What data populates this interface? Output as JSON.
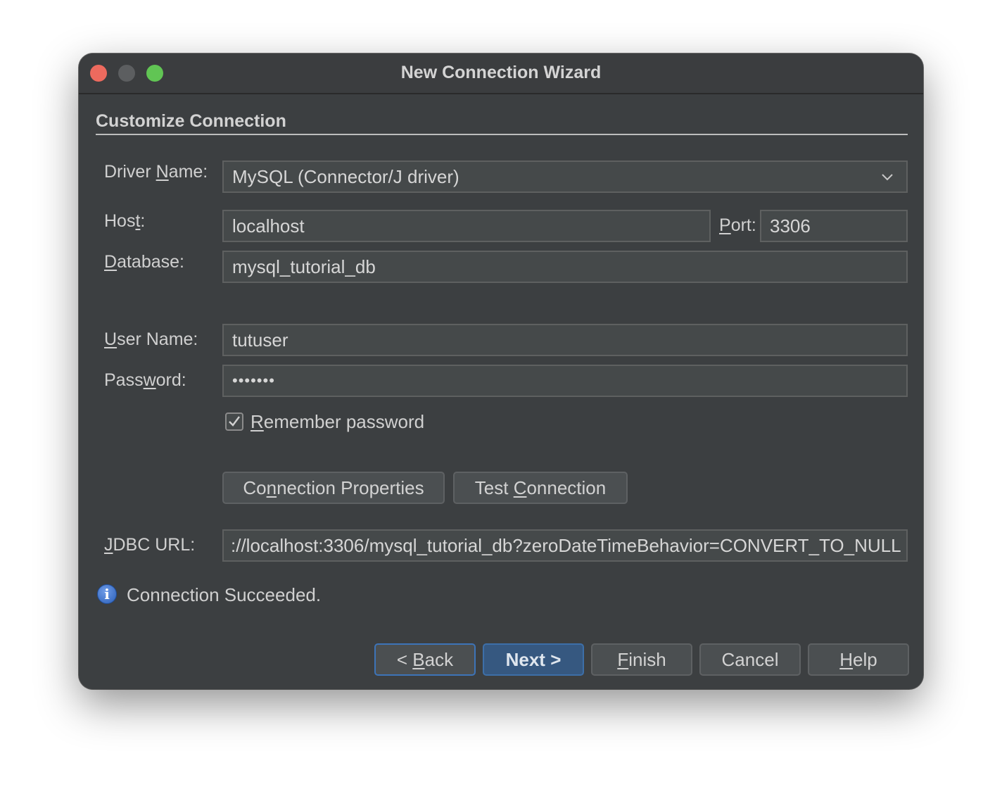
{
  "window": {
    "title": "New Connection Wizard"
  },
  "section": {
    "title": "Customize Connection"
  },
  "form": {
    "driver": {
      "label_pre": "Driver ",
      "label_mn": "N",
      "label_post": "ame:",
      "value": "MySQL (Connector/J driver)"
    },
    "host": {
      "label_pre": "Hos",
      "label_mn": "t",
      "label_post": ":",
      "value": "localhost"
    },
    "port": {
      "label_pre": "",
      "label_mn": "P",
      "label_post": "ort:",
      "value": "3306"
    },
    "database": {
      "label_pre": "",
      "label_mn": "D",
      "label_post": "atabase:",
      "value": "mysql_tutorial_db"
    },
    "username": {
      "label_pre": "",
      "label_mn": "U",
      "label_post": "ser Name:",
      "value": "tutuser"
    },
    "password": {
      "label_pre": "Pass",
      "label_mn": "w",
      "label_post": "ord:",
      "value": "•••••••"
    },
    "remember": {
      "label_pre": "",
      "label_mn": "R",
      "label_post": "emember password",
      "checked": true
    },
    "jdbc": {
      "label_pre": "",
      "label_mn": "J",
      "label_post": "DBC URL:",
      "value": "://localhost:3306/mysql_tutorial_db?zeroDateTimeBehavior=CONVERT_TO_NULL"
    }
  },
  "actions": {
    "connection_properties": {
      "pre": "Co",
      "mn": "n",
      "post": "nection Properties"
    },
    "test_connection": {
      "pre": "Test ",
      "mn": "C",
      "post": "onnection"
    }
  },
  "status": {
    "icon": "info-icon",
    "icon_glyph": "i",
    "text": "Connection Succeeded."
  },
  "footer": {
    "back": {
      "pre": "< ",
      "mn": "B",
      "post": "ack"
    },
    "next": {
      "label": "Next >"
    },
    "finish": {
      "pre": "",
      "mn": "F",
      "post": "inish"
    },
    "cancel": {
      "label": "Cancel"
    },
    "help": {
      "pre": "",
      "mn": "H",
      "post": "elp"
    }
  },
  "colors": {
    "dialog_bg": "#3c3f41",
    "field_bg": "#45494a",
    "default_button": "#365880",
    "focus_border": "#3d74b8"
  }
}
